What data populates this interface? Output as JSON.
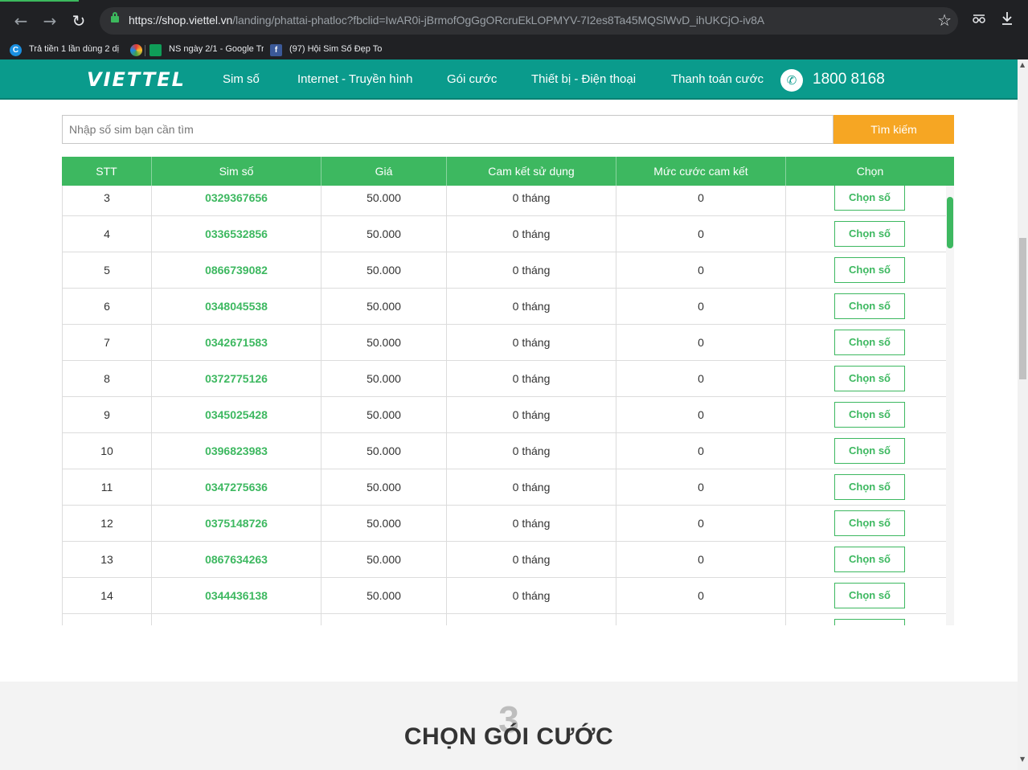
{
  "browser": {
    "back": "←",
    "forward": "→",
    "reload": "↻",
    "url_host": "https://shop.viettel.vn",
    "url_path": "/landing/phattai-phatloc?fbclid=IwAR0i-jBrmofOgGgORcruEkLOPMYV-7I2es8Ta45MQSlWvD_ihUKCjO-iv8A",
    "star": "☆",
    "bookmarks": [
      {
        "icon": "C",
        "label": "Trả tiền 1 lần dùng 2 dị"
      },
      {
        "icon": "",
        "label": ""
      },
      {
        "icon": "",
        "label": "NS ngày 2/1 - Google Tr"
      },
      {
        "icon": "f",
        "label": "(97) Hội Sim Số Đẹp To"
      }
    ]
  },
  "header": {
    "logo": "VIETTEL",
    "nav": [
      "Sim số",
      "Internet - Truyền hình",
      "Gói cước",
      "Thiết bị - Điện thoại",
      "Thanh toán cước"
    ],
    "hotline": "1800 8168",
    "colors": {
      "primary": "#0a9b8c",
      "accent": "#3db860",
      "button": "#f6a623"
    }
  },
  "search": {
    "placeholder": "Nhập số sim bạn cần tìm",
    "value": "",
    "button": "Tìm kiếm"
  },
  "table": {
    "columns": [
      "STT",
      "Sim số",
      "Giá",
      "Cam kết sử dụng",
      "Mức cước cam kết",
      "Chọn"
    ],
    "button_label": "Chọn số",
    "rows": [
      {
        "stt": "3",
        "sim": "0329367656",
        "price": "50.000",
        "commit": "0 tháng",
        "fee": "0"
      },
      {
        "stt": "4",
        "sim": "0336532856",
        "price": "50.000",
        "commit": "0 tháng",
        "fee": "0"
      },
      {
        "stt": "5",
        "sim": "0866739082",
        "price": "50.000",
        "commit": "0 tháng",
        "fee": "0"
      },
      {
        "stt": "6",
        "sim": "0348045538",
        "price": "50.000",
        "commit": "0 tháng",
        "fee": "0"
      },
      {
        "stt": "7",
        "sim": "0342671583",
        "price": "50.000",
        "commit": "0 tháng",
        "fee": "0"
      },
      {
        "stt": "8",
        "sim": "0372775126",
        "price": "50.000",
        "commit": "0 tháng",
        "fee": "0"
      },
      {
        "stt": "9",
        "sim": "0345025428",
        "price": "50.000",
        "commit": "0 tháng",
        "fee": "0"
      },
      {
        "stt": "10",
        "sim": "0396823983",
        "price": "50.000",
        "commit": "0 tháng",
        "fee": "0"
      },
      {
        "stt": "11",
        "sim": "0347275636",
        "price": "50.000",
        "commit": "0 tháng",
        "fee": "0"
      },
      {
        "stt": "12",
        "sim": "0375148726",
        "price": "50.000",
        "commit": "0 tháng",
        "fee": "0"
      },
      {
        "stt": "13",
        "sim": "0867634263",
        "price": "50.000",
        "commit": "0 tháng",
        "fee": "0"
      },
      {
        "stt": "14",
        "sim": "0344436138",
        "price": "50.000",
        "commit": "0 tháng",
        "fee": "0"
      },
      {
        "stt": "",
        "sim": "",
        "price": "",
        "commit": "",
        "fee": ""
      }
    ]
  },
  "section3": {
    "step": "3",
    "title": "CHỌN GÓI CƯỚC"
  }
}
